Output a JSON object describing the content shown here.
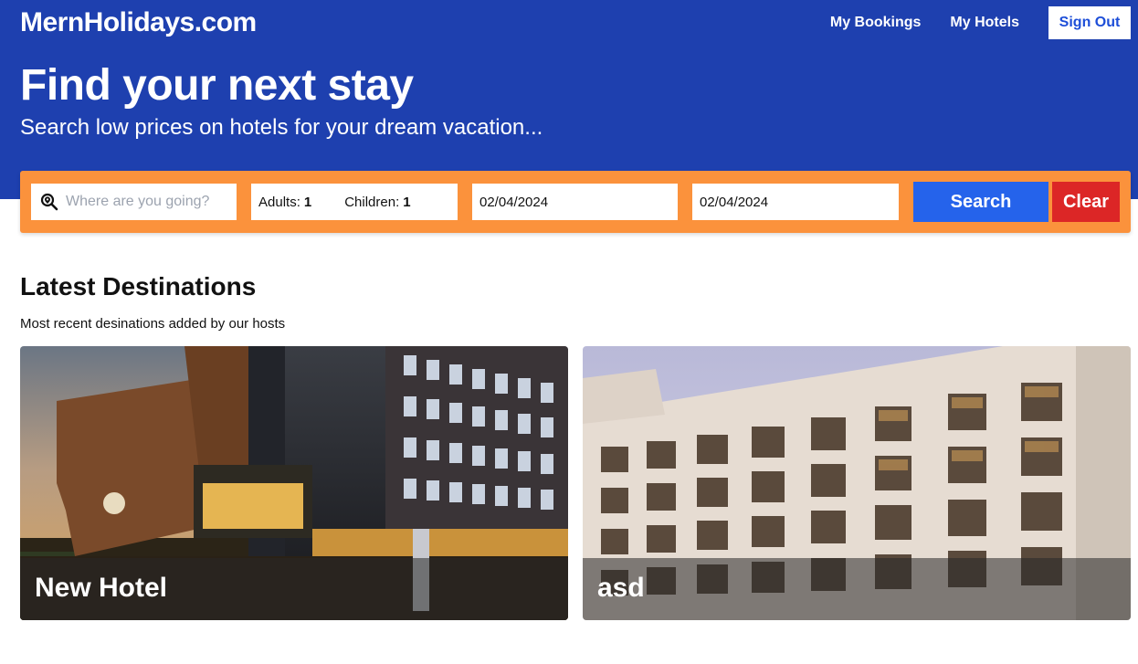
{
  "header": {
    "brand": "MernHolidays.com",
    "nav": {
      "my_bookings": "My Bookings",
      "my_hotels": "My Hotels",
      "sign_out": "Sign Out"
    }
  },
  "hero": {
    "title": "Find your next stay",
    "subtitle": "Search low prices on hotels for your dream vacation..."
  },
  "search": {
    "destination_placeholder": "Where are you going?",
    "adults_label": "Adults:",
    "adults_value": "1",
    "children_label": "Children:",
    "children_value": "1",
    "check_in": "02/04/2024",
    "check_out": "02/04/2024",
    "search_label": "Search",
    "clear_label": "Clear"
  },
  "destinations": {
    "title": "Latest Destinations",
    "subtitle": "Most recent desinations added by our hosts",
    "items": [
      {
        "name": "New Hotel"
      },
      {
        "name": "asd"
      }
    ]
  },
  "colors": {
    "hero_blue": "#1e40af",
    "search_bar_orange": "#fb923c",
    "search_button_blue": "#2563eb",
    "clear_button_red": "#dc2626"
  }
}
